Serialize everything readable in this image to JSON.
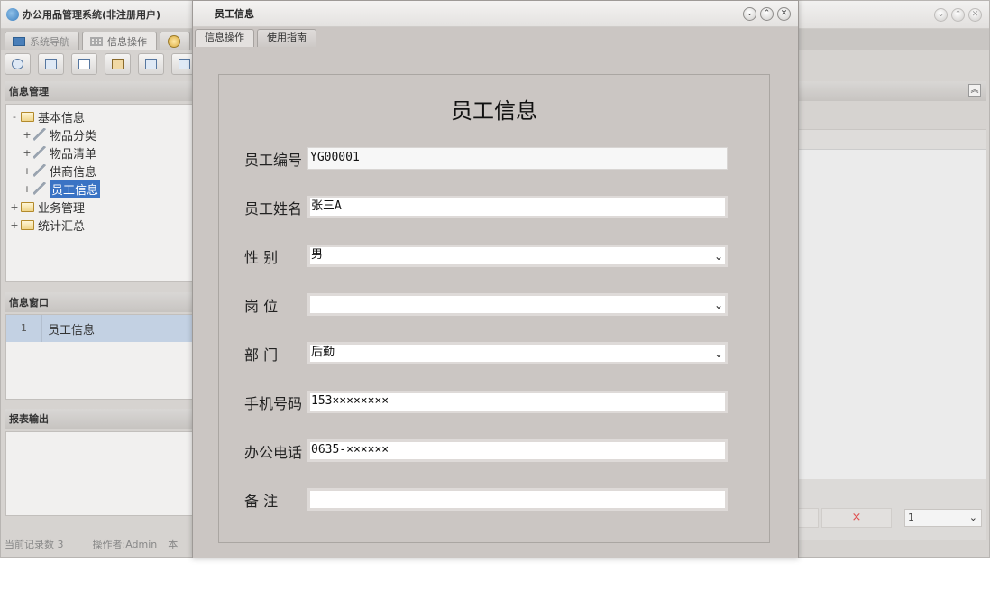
{
  "main": {
    "title": "办公用品管理系统(非注册用户)",
    "tabs": [
      {
        "label": "系统导航",
        "icon": "monitor-icon"
      },
      {
        "label": "信息操作",
        "icon": "grid-icon"
      },
      {
        "label": "",
        "icon": "clock-icon"
      }
    ],
    "toolbar_icons": [
      "search-icon",
      "layout-icon",
      "document-icon",
      "users-icon",
      "window-icon",
      "export-icon"
    ],
    "info_panel": {
      "title": "信息管理",
      "tree": [
        {
          "label": "基本信息",
          "exp": "-",
          "type": "folder",
          "level": 0
        },
        {
          "label": "物品分类",
          "exp": "+",
          "type": "leaf",
          "level": 1
        },
        {
          "label": "物品清单",
          "exp": "+",
          "type": "leaf",
          "level": 1
        },
        {
          "label": "供商信息",
          "exp": "+",
          "type": "leaf",
          "level": 1
        },
        {
          "label": "员工信息",
          "exp": "+",
          "type": "leaf",
          "level": 1,
          "selected": true
        },
        {
          "label": "业务管理",
          "exp": "+",
          "type": "folder",
          "level": 0
        },
        {
          "label": "统计汇总",
          "exp": "+",
          "type": "folder",
          "level": 0
        }
      ]
    },
    "window_panel": {
      "title": "信息窗口",
      "items": [
        {
          "index": "1",
          "label": "员工信息"
        }
      ]
    },
    "report_panel": {
      "title": "报表输出"
    },
    "status": {
      "records": "当前记录数 3",
      "operator": "操作者:Admin",
      "extra": "本"
    },
    "right": {
      "cancel_symbol": "×",
      "page_value": "1"
    }
  },
  "dialog": {
    "title": "员工信息",
    "tabs": [
      "信息操作",
      "使用指南"
    ],
    "form_title": "员工信息",
    "fields": [
      {
        "label": "员工编号",
        "value": "YG00001",
        "kind": "readonly"
      },
      {
        "label": "员工姓名",
        "value": "张三A",
        "kind": "text"
      },
      {
        "label": "性 别",
        "value": "男",
        "kind": "select"
      },
      {
        "label": "岗 位",
        "value": "",
        "kind": "select"
      },
      {
        "label": "部 门",
        "value": "后勤",
        "kind": "select"
      },
      {
        "label": "手机号码",
        "value": "153××××××××",
        "kind": "text"
      },
      {
        "label": "办公电话",
        "value": "0635-××××××",
        "kind": "text"
      },
      {
        "label": "备 注",
        "value": "",
        "kind": "text"
      }
    ]
  },
  "colors": {
    "selection": "#3a73c4",
    "window_list_row": "#c3d1e3",
    "dialog_bg": "#cbc6c3",
    "cancel": "#e05050"
  }
}
